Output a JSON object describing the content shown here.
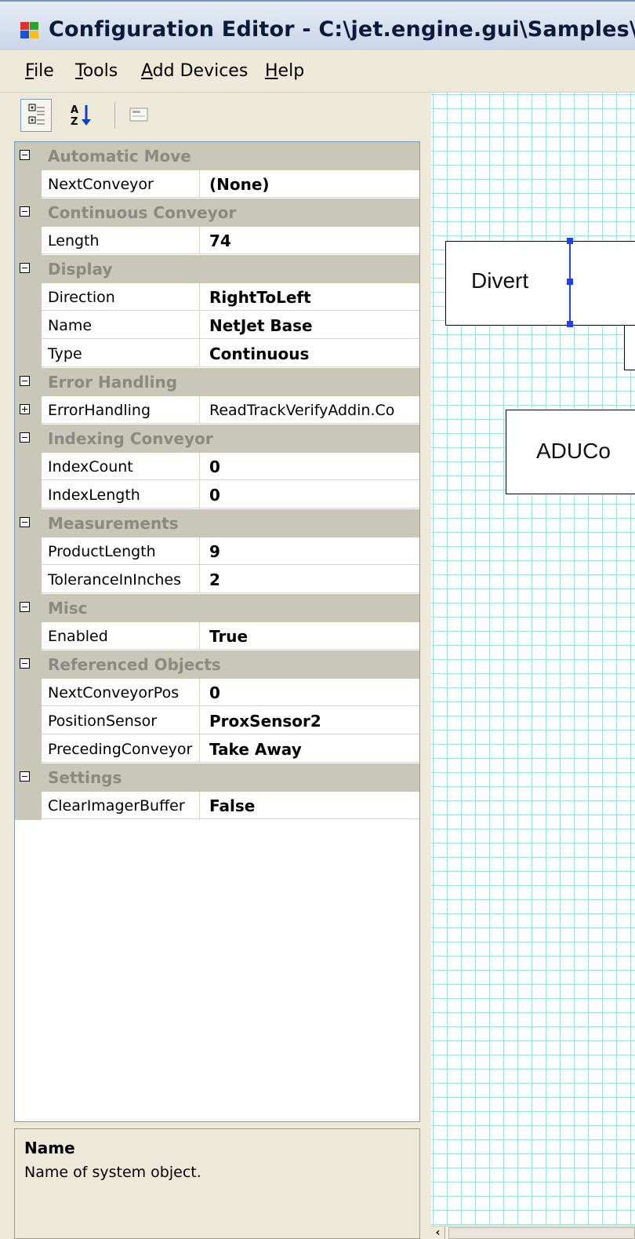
{
  "window": {
    "title": "Configuration Editor - C:\\jet.engine.gui\\Samples\\Swi"
  },
  "menu": {
    "items": [
      {
        "label": "File",
        "mnemonic": "F",
        "rest": "ile"
      },
      {
        "label": "Tools",
        "mnemonic": "T",
        "rest": "ools"
      },
      {
        "label": "Add Devices",
        "mnemonic": "A",
        "rest": "dd Devices"
      },
      {
        "label": "Help",
        "mnemonic": "H",
        "rest": "elp"
      }
    ]
  },
  "toolbar": {
    "categorized_icon": "categorized-icon",
    "alphabetical_icon": "alphabetical-icon",
    "property_pages_icon": "property-pages-icon"
  },
  "property_grid": {
    "categories": [
      {
        "name": "Automatic Move",
        "properties": [
          {
            "name": "NextConveyor",
            "value": "(None)"
          }
        ]
      },
      {
        "name": "Continuous Conveyor",
        "properties": [
          {
            "name": "Length",
            "value": "74"
          }
        ]
      },
      {
        "name": "Display",
        "properties": [
          {
            "name": "Direction",
            "value": "RightToLeft"
          },
          {
            "name": "Name",
            "value": "NetJet Base"
          },
          {
            "name": "Type",
            "value": "Continuous"
          }
        ]
      },
      {
        "name": "Error Handling",
        "properties": [
          {
            "name": "ErrorHandling",
            "value": "ReadTrackVerifyAddin.Co",
            "expandable": true
          }
        ]
      },
      {
        "name": "Indexing Conveyor",
        "properties": [
          {
            "name": "IndexCount",
            "value": "0"
          },
          {
            "name": "IndexLength",
            "value": "0"
          }
        ]
      },
      {
        "name": "Measurements",
        "properties": [
          {
            "name": "ProductLength",
            "value": "9"
          },
          {
            "name": "ToleranceInInches",
            "value": "2"
          }
        ]
      },
      {
        "name": "Misc",
        "properties": [
          {
            "name": "Enabled",
            "value": "True"
          }
        ]
      },
      {
        "name": "Referenced Objects",
        "properties": [
          {
            "name": "NextConveyorPos",
            "value": "0"
          },
          {
            "name": "PositionSensor",
            "value": "ProxSensor2"
          },
          {
            "name": "PrecedingConveyor",
            "value": "Take Away"
          }
        ]
      },
      {
        "name": "Settings",
        "properties": [
          {
            "name": "ClearImagerBuffer",
            "value": "False"
          }
        ]
      }
    ]
  },
  "help": {
    "title": "Name",
    "description": "Name of system object."
  },
  "canvas": {
    "blocks": [
      {
        "label": "Divert"
      },
      {
        "label": "ADUCo"
      }
    ]
  },
  "colors": {
    "grid_line": "#9fe0e0",
    "selection_handle": "#1f3fff",
    "category_bg": "#c9c7b8",
    "category_text": "#8a8a80"
  }
}
